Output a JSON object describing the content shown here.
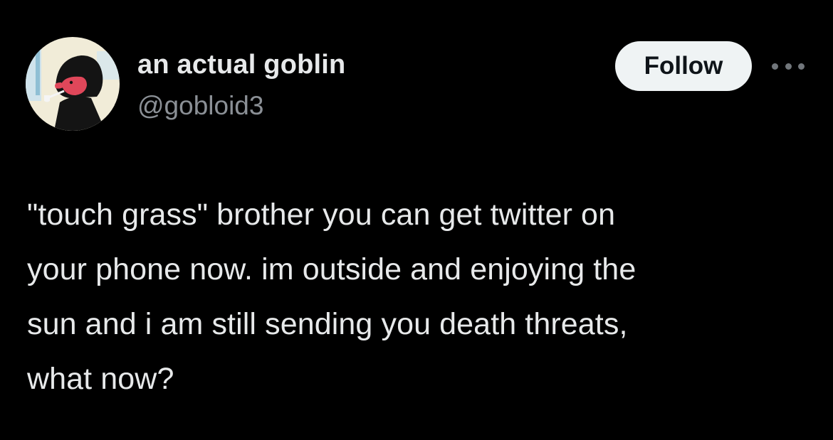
{
  "user": {
    "display_name": "an actual goblin",
    "handle": "@gobloid3"
  },
  "actions": {
    "follow_label": "Follow",
    "more_icon": "more-horizontal-icon"
  },
  "tweet": {
    "lines": [
      "\"touch grass\" brother you can get twitter on",
      "your phone now. im outside and enjoying the",
      "sun and i am still sending you death threats,",
      "what now?"
    ]
  },
  "colors": {
    "background": "#000000",
    "text_primary": "#e7e9ea",
    "text_secondary": "#8b9096",
    "follow_bg": "#eff3f4",
    "follow_text": "#0f1419"
  }
}
